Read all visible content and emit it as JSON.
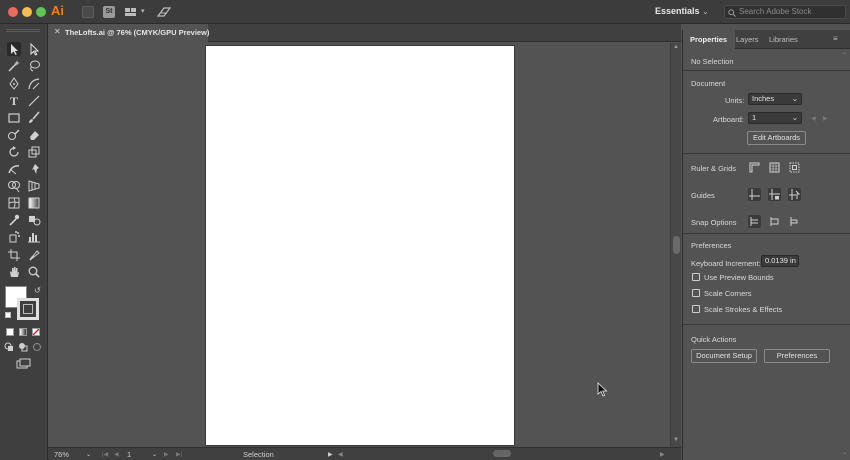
{
  "colors": {
    "close": "#ed6a5e",
    "minimize": "#f5bf4f",
    "zoom": "#61c554",
    "brand": "#ff7c00"
  },
  "app": {
    "logo": "Ai",
    "workspace": "Essentials",
    "search_placeholder": "Search Adobe Stock"
  },
  "document": {
    "tab_title": "TheLofts.ai @ 76% (CMYK/GPU Preview)"
  },
  "toolbar": {
    "tools": [
      "selection-tool",
      "direct-selection-tool",
      "magic-wand-tool",
      "lasso-tool",
      "pen-tool",
      "curvature-tool",
      "type-tool",
      "line-tool",
      "rectangle-tool",
      "paintbrush-tool",
      "shaper-tool",
      "eraser-tool",
      "rotate-tool",
      "scale-tool",
      "warp-tool",
      "puppet-warp-tool",
      "shape-builder-tool",
      "perspective-grid-tool",
      "mesh-tool",
      "gradient-tool",
      "eyedropper-tool",
      "blend-tool",
      "symbol-sprayer-tool",
      "column-graph-tool",
      "artboard-tool",
      "slice-tool",
      "hand-tool",
      "zoom-tool"
    ]
  },
  "status": {
    "zoom": "76%",
    "artboard_num": "1",
    "tool_name": "Selection"
  },
  "panel": {
    "tabs": [
      "Properties",
      "Layers",
      "Libraries"
    ],
    "no_selection": "No Selection",
    "document_heading": "Document",
    "units_label": "Units:",
    "units_value": "Inches",
    "artboard_label": "Artboard:",
    "artboard_value": "1",
    "edit_artboards": "Edit Artboards",
    "ruler_grids": "Ruler & Grids",
    "guides": "Guides",
    "snap_options": "Snap Options",
    "preferences_heading": "Preferences",
    "keyboard_increment_label": "Keyboard Increment:",
    "keyboard_increment_value": "0.0139 in",
    "use_preview_bounds": "Use Preview Bounds",
    "scale_corners": "Scale Corners",
    "scale_strokes_effects": "Scale Strokes & Effects",
    "quick_actions": "Quick Actions",
    "document_setup_btn": "Document Setup",
    "preferences_btn": "Preferences"
  }
}
